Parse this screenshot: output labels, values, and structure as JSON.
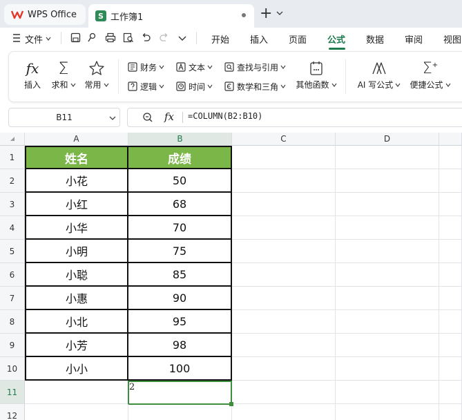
{
  "tabs": {
    "app": "WPS Office",
    "workbook": "工作簿1"
  },
  "menu": {
    "file": "文件",
    "items": [
      "开始",
      "插入",
      "页面",
      "公式",
      "数据",
      "审阅",
      "视图"
    ],
    "active": "公式"
  },
  "ribbon": {
    "insert": "插入",
    "autosum": "求和",
    "common": "常用",
    "finance": "财务",
    "text": "文本",
    "lookup": "查找与引用",
    "logic": "逻辑",
    "time": "时间",
    "math": "数学和三角",
    "other": "其他函数",
    "ai_formula": "AI 写公式",
    "quick_formula": "便捷公式"
  },
  "formula_bar": {
    "cell_ref": "B11",
    "fx": "fx",
    "formula": "=COLUMN(B2:B10)"
  },
  "grid": {
    "columns": [
      "A",
      "B",
      "C",
      "D"
    ],
    "rows": [
      "1",
      "2",
      "3",
      "4",
      "5",
      "6",
      "7",
      "8",
      "9",
      "10",
      "11",
      "12"
    ],
    "header": [
      "姓名",
      "成绩"
    ],
    "records": [
      [
        "小花",
        "50"
      ],
      [
        "小红",
        "68"
      ],
      [
        "小华",
        "70"
      ],
      [
        "小明",
        "75"
      ],
      [
        "小聪",
        "85"
      ],
      [
        "小惠",
        "90"
      ],
      [
        "小北",
        "95"
      ],
      [
        "小芳",
        "98"
      ],
      [
        "小小",
        "100"
      ]
    ],
    "selected_value": "2"
  },
  "colors": {
    "accent": "#1f7a4d",
    "header_fill": "#7ab648",
    "selection": "#3d8f3d"
  }
}
